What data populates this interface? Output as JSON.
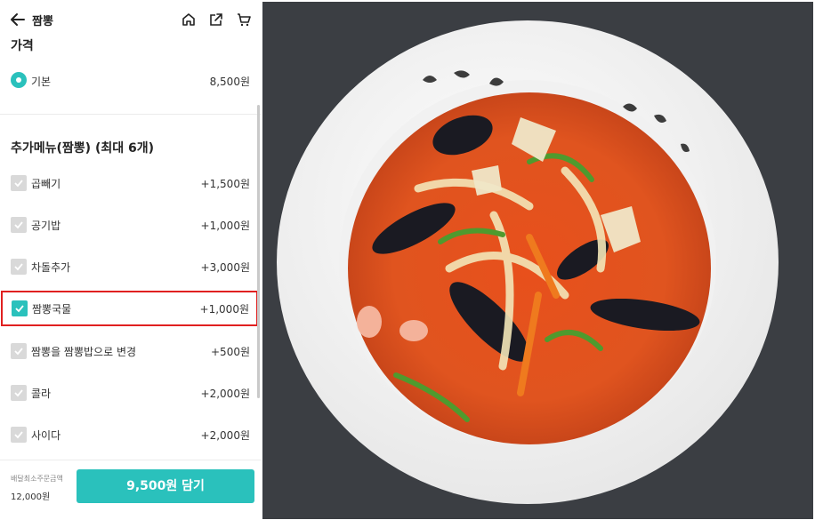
{
  "header": {
    "title": "짬뽕",
    "back_icon": "arrow-left-icon",
    "icons": [
      "home-icon",
      "share-icon",
      "cart-icon"
    ]
  },
  "price_section": {
    "title": "가격",
    "option": {
      "label": "기본",
      "price": "8,500원",
      "selected": true
    }
  },
  "extras_section": {
    "title": "추가메뉴(짬뽕) (최대 6개)",
    "items": [
      {
        "label": "곱빼기",
        "price": "+1,500원",
        "checked": false
      },
      {
        "label": "공기밥",
        "price": "+1,000원",
        "checked": false
      },
      {
        "label": "차돌추가",
        "price": "+3,000원",
        "checked": false
      },
      {
        "label": "짬뽕국물",
        "price": "+1,000원",
        "checked": true
      },
      {
        "label": "짬뽕을 짬뽕밥으로 변경",
        "price": "+500원",
        "checked": false
      },
      {
        "label": "콜라",
        "price": "+2,000원",
        "checked": false
      },
      {
        "label": "사이다",
        "price": "+2,000원",
        "checked": false
      }
    ]
  },
  "footer": {
    "min_order_label": "배달최소주문금액",
    "min_order_value": "12,000원",
    "add_button": "9,500원 담기"
  },
  "colors": {
    "accent": "#2ac1bc",
    "highlight": "#e02020",
    "checkbox_off": "#d9d9d9"
  },
  "photo": {
    "subject": "jjamppong-bowl-image"
  }
}
